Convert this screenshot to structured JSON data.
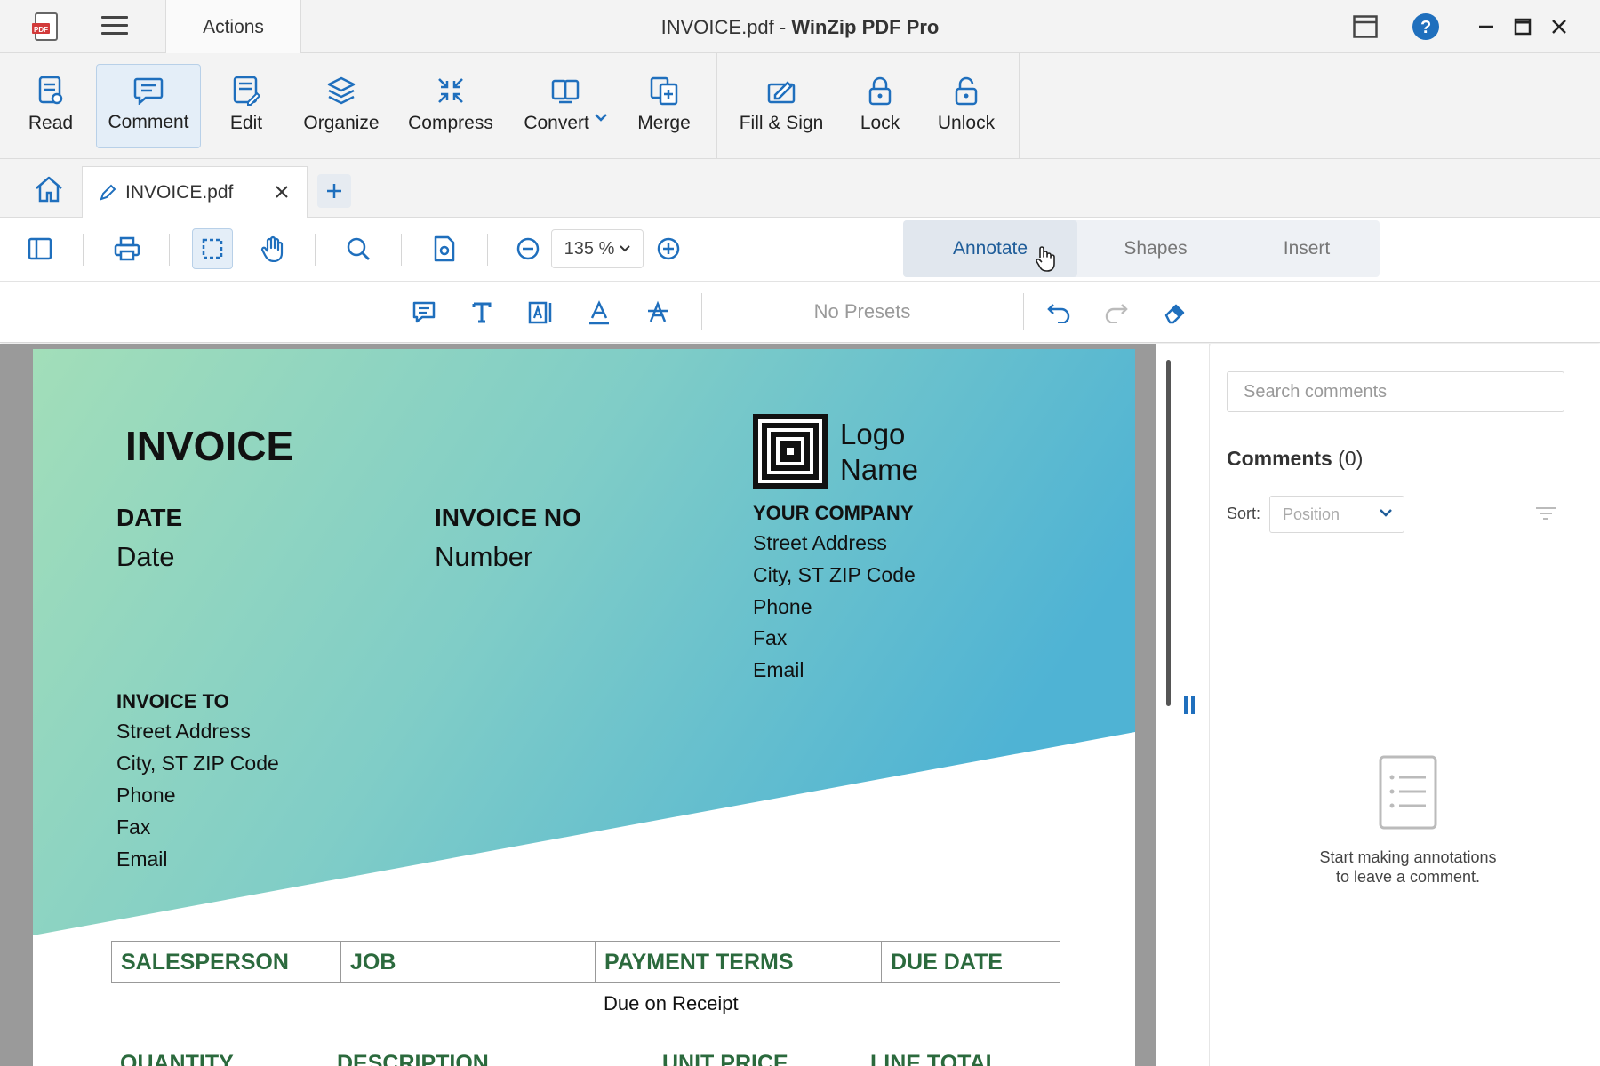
{
  "titlebar": {
    "actions_label": "Actions",
    "file_name": "INVOICE.pdf",
    "separator": " - ",
    "app_name": "WinZip PDF Pro"
  },
  "ribbon": {
    "read": "Read",
    "comment": "Comment",
    "edit": "Edit",
    "organize": "Organize",
    "compress": "Compress",
    "convert": "Convert",
    "merge": "Merge",
    "fill_sign": "Fill & Sign",
    "lock": "Lock",
    "unlock": "Unlock"
  },
  "tabs": {
    "doc_tab_label": "INVOICE.pdf"
  },
  "toolbar": {
    "zoom": "135 %",
    "mode_tabs": [
      "Annotate",
      "Shapes",
      "Insert"
    ],
    "active_mode": "Annotate"
  },
  "annotate": {
    "presets": "No Presets"
  },
  "invoice": {
    "title": "INVOICE",
    "logo_line1": "Logo",
    "logo_line2": "Name",
    "date_label": "DATE",
    "date_value": "Date",
    "invoice_no_label": "INVOICE NO",
    "invoice_no_value": "Number",
    "company_label": "YOUR COMPANY",
    "company_lines": [
      "Street Address",
      "City, ST ZIP Code",
      "Phone",
      "Fax",
      "Email"
    ],
    "invoice_to_label": "INVOICE TO",
    "invoice_to_lines": [
      "Street Address",
      "City, ST ZIP Code",
      "Phone",
      "Fax",
      "Email"
    ],
    "table_headers": [
      "SALESPERSON",
      "JOB",
      "PAYMENT TERMS",
      "DUE DATE"
    ],
    "payment_terms_value": "Due on Receipt",
    "table2_headers": [
      "QUANTITY",
      "DESCRIPTION",
      "UNIT PRICE",
      "LINE TOTAL"
    ]
  },
  "comments": {
    "search_placeholder": "Search comments",
    "title": "Comments",
    "count": "(0)",
    "sort_label": "Sort:",
    "sort_value": "Position",
    "empty_line1": "Start making annotations",
    "empty_line2": "to leave a comment."
  },
  "colors": {
    "accent": "#1f5d99",
    "gradient_start": "#9fdcb8",
    "gradient_end": "#4fb3d4",
    "table_header_text": "#2b6a3d"
  },
  "icons": {
    "app": "winzip-pdf-icon",
    "menu": "hamburger-icon",
    "layout": "layout-icon",
    "help": "help-icon",
    "minimize": "minimize-icon",
    "maximize": "maximize-icon",
    "close": "close-icon"
  }
}
